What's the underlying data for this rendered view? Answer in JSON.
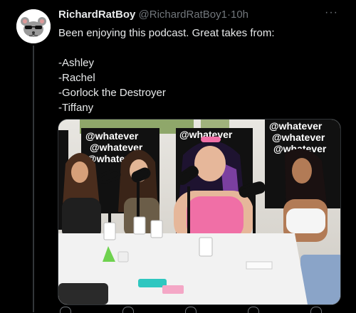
{
  "tweet": {
    "display_name": "RichardRatBoy",
    "handle": "@RichardRatBoy1",
    "separator": "·",
    "time": "10h",
    "text_intro": "Been enjoying this podcast. Great takes from:",
    "list": [
      "-Ashley",
      "-Rachel",
      "-Gorlock the Destroyer",
      "-Tiffany"
    ],
    "more_label": "···"
  },
  "media": {
    "backdrop_text": "@whatever",
    "podium_colors": [
      "#f2f2f2",
      "#2a2a2a"
    ],
    "accent_pink": "#f06fa6",
    "hair_purple": "#7b3fa0"
  },
  "icons": [
    "avatar-rat-icon",
    "more-icon",
    "reply-icon",
    "retweet-icon",
    "like-icon",
    "views-icon",
    "share-icon"
  ]
}
